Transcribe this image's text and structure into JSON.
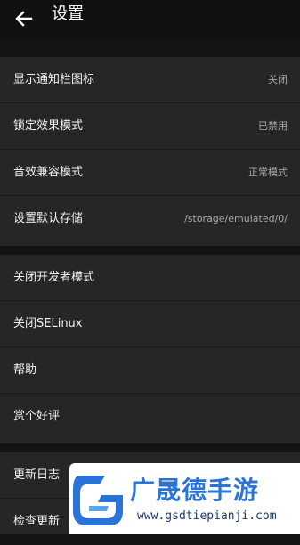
{
  "header": {
    "title": "设置",
    "back_icon": "arrow-left-icon"
  },
  "group1": {
    "items": [
      {
        "label": "显示通知栏图标",
        "value": "关闭"
      },
      {
        "label": "锁定效果模式",
        "value": "已禁用"
      },
      {
        "label": "音效兼容模式",
        "value": "正常模式"
      },
      {
        "label": "设置默认存储",
        "value": "/storage/emulated/0/"
      }
    ]
  },
  "group2": {
    "items": [
      {
        "label": "关闭开发者模式"
      },
      {
        "label": "关闭SELinux"
      },
      {
        "label": "帮助"
      },
      {
        "label": "赏个好评"
      }
    ]
  },
  "group3": {
    "items": [
      {
        "label": "更新日志"
      },
      {
        "label": "检查更新"
      }
    ]
  },
  "watermark": {
    "name": "广晟德手游",
    "url": "www.gsdtiepianji.com"
  }
}
